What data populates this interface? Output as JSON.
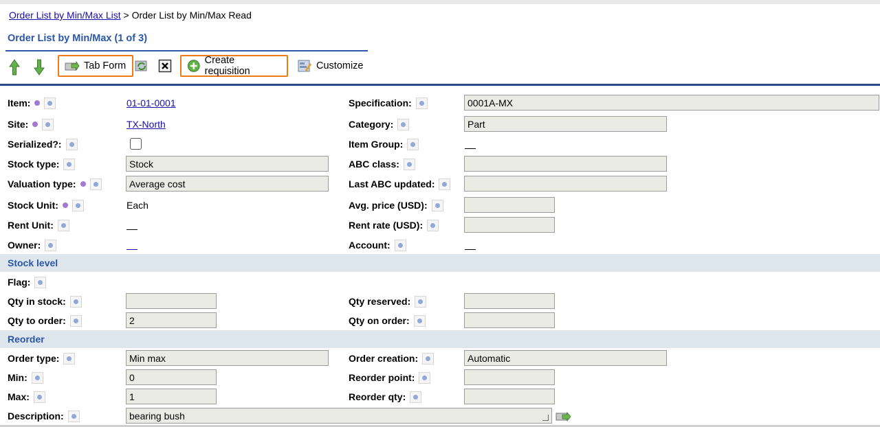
{
  "breadcrumb": {
    "link": "Order List by Min/Max List",
    "separator": " > ",
    "current": "Order List by Min/Max Read"
  },
  "title": "Order List by Min/Max (1 of 3)",
  "toolbar": {
    "up_icon": "arrow-up-icon",
    "down_icon": "arrow-down-icon",
    "tab_form": "Tab Form",
    "refresh_icon": "refresh-icon",
    "close_icon": "close-icon",
    "create_requisition": "Create requisition",
    "customize": "Customize"
  },
  "fields": {
    "item": {
      "label": "Item:",
      "value": "01-01-0001"
    },
    "specification": {
      "label": "Specification:",
      "value": "0001A-MX"
    },
    "site": {
      "label": "Site:",
      "value": "TX-North"
    },
    "category": {
      "label": "Category:",
      "value": "Part"
    },
    "serialized": {
      "label": "Serialized?:",
      "checked": false
    },
    "item_group": {
      "label": "Item Group:",
      "value": ""
    },
    "stock_type": {
      "label": "Stock type:",
      "value": "Stock"
    },
    "abc_class": {
      "label": "ABC class:",
      "value": ""
    },
    "valuation_type": {
      "label": "Valuation type:",
      "value": "Average cost"
    },
    "last_abc_updated": {
      "label": "Last ABC updated:",
      "value": ""
    },
    "stock_unit": {
      "label": "Stock Unit:",
      "value": "Each"
    },
    "avg_price": {
      "label": "Avg. price (USD):",
      "value": ""
    },
    "rent_unit": {
      "label": "Rent Unit:",
      "value": ""
    },
    "rent_rate": {
      "label": "Rent rate (USD):",
      "value": ""
    },
    "owner": {
      "label": "Owner:",
      "value": ""
    },
    "account": {
      "label": "Account:",
      "value": ""
    }
  },
  "stock_level": {
    "header": "Stock level",
    "flag": {
      "label": "Flag:"
    },
    "qty_in_stock": {
      "label": "Qty in stock:",
      "value": ""
    },
    "qty_reserved": {
      "label": "Qty reserved:",
      "value": ""
    },
    "qty_to_order": {
      "label": "Qty to order:",
      "value": "2"
    },
    "qty_on_order": {
      "label": "Qty on order:",
      "value": ""
    }
  },
  "reorder": {
    "header": "Reorder",
    "order_type": {
      "label": "Order type:",
      "value": "Min max"
    },
    "order_creation": {
      "label": "Order creation:",
      "value": "Automatic"
    },
    "min": {
      "label": "Min:",
      "value": "0"
    },
    "reorder_point": {
      "label": "Reorder point:",
      "value": ""
    },
    "max": {
      "label": "Max:",
      "value": "1"
    },
    "reorder_qty": {
      "label": "Reorder qty:",
      "value": ""
    },
    "description": {
      "label": "Description:",
      "value": "bearing bush"
    }
  },
  "colors": {
    "accent": "#2a56a8",
    "highlight_border": "#f07b14",
    "section_bg": "#dde6ec",
    "field_bg": "#ebebe6"
  }
}
